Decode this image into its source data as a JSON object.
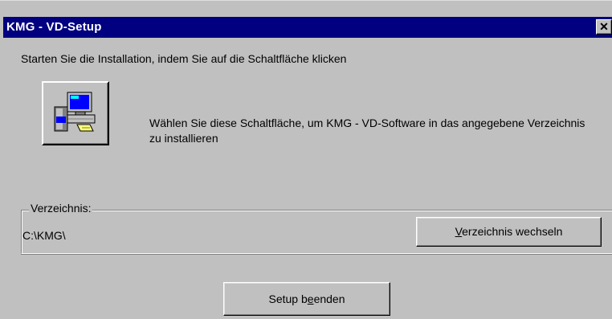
{
  "window": {
    "title": "KMG - VD-Setup",
    "close_label": "✕"
  },
  "instruction": "Starten Sie die Installation, indem Sie auf die Schaltfläche klicken",
  "install_button": {
    "icon": "computer-setup-icon",
    "description": "Wählen Sie diese Schaltfläche, um KMG - VD-Software in das angegebene Verzeichnis zu installieren"
  },
  "directory_group": {
    "legend": "Verzeichnis:",
    "path": "C:\\KMG\\",
    "change_button": {
      "accel": "V",
      "rest": "erzeichnis wechseln"
    }
  },
  "exit_button": {
    "pre": "Setup b",
    "accel": "e",
    "post": "enden"
  },
  "colors": {
    "titlebar": "#000080",
    "face": "#c0c0c0"
  }
}
